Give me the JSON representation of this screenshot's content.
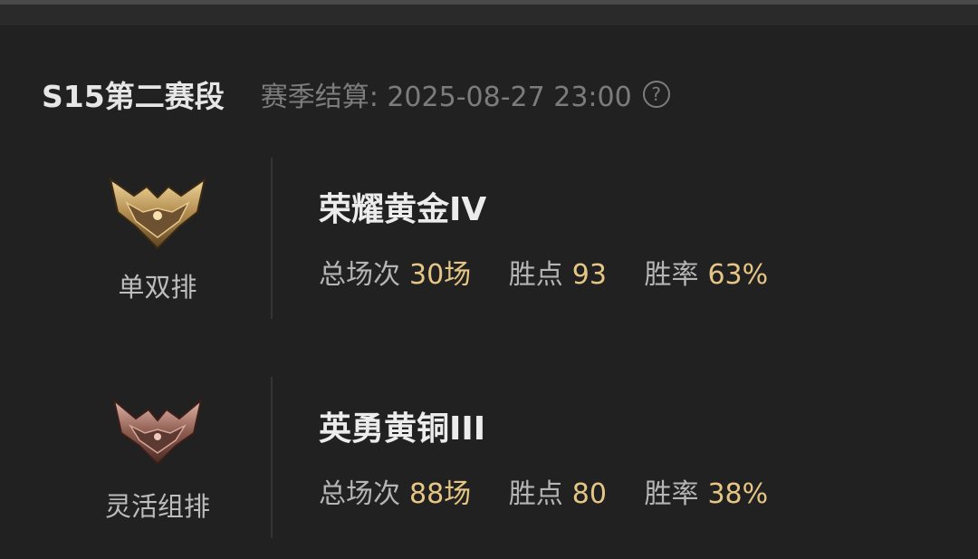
{
  "season": {
    "title": "S15第二赛段",
    "settlement": "赛季结算: 2025-08-27 23:00",
    "help_icon": "question-circle-icon"
  },
  "queues": [
    {
      "name": "单双排",
      "emblem": "gold-emblem-icon",
      "emblem_color": "#c9a46a",
      "rank": "荣耀黄金IV",
      "stats": [
        {
          "label": "总场次",
          "value": "30场"
        },
        {
          "label": "胜点",
          "value": "93"
        },
        {
          "label": "胜率",
          "value": "63%"
        }
      ]
    },
    {
      "name": "灵活组排",
      "emblem": "bronze-emblem-icon",
      "emblem_color": "#a97a6c",
      "rank": "英勇黄铜III",
      "stats": [
        {
          "label": "总场次",
          "value": "88场"
        },
        {
          "label": "胜点",
          "value": "80"
        },
        {
          "label": "胜率",
          "value": "38%"
        }
      ]
    }
  ],
  "colors": {
    "accent": "#e6c685",
    "background": "#212121",
    "muted_text": "#7c7c7c"
  }
}
